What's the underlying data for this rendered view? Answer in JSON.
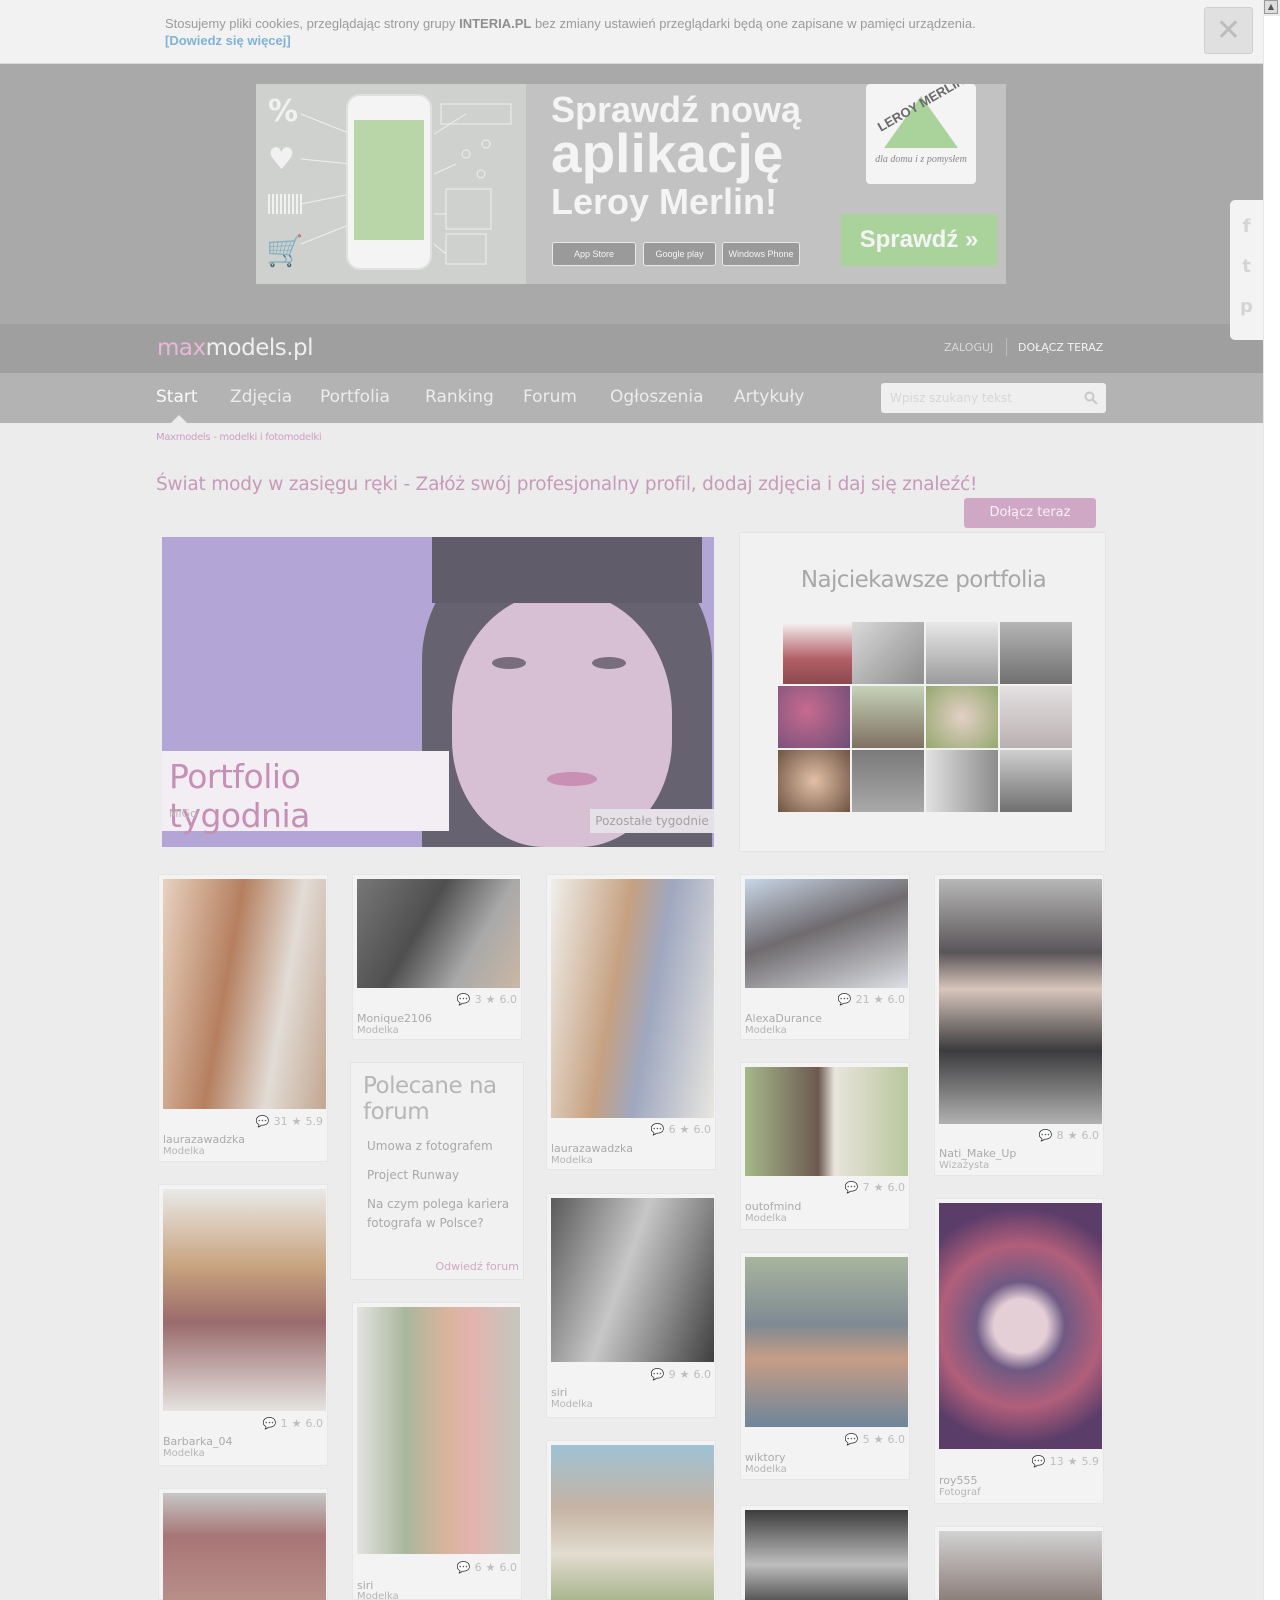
{
  "cookie": {
    "text_before": "Stosujemy pliki cookies, przeglądając strony grupy ",
    "brand": "INTERIA.PL",
    "text_after": " bez zmiany ustawień przeglądarki będą one zapisane w pamięci urządzenia.",
    "more_link": "[Dowiedz się więcej]",
    "close_glyph": "✕"
  },
  "ad": {
    "line1": "Sprawdź nową",
    "line2": "aplikację",
    "line3": "Leroy Merlin!",
    "store1": "App Store",
    "store2": "Google play",
    "store3": "Windows Phone",
    "logo_text": "LEROY MERLIN",
    "logo_sub": "dla domu i z pomysłem",
    "button": "Sprawdź »"
  },
  "header": {
    "logo_max": "max",
    "logo_rest": "models.pl",
    "login": "ZALOGUJ",
    "join": "DOŁĄCZ TERAZ"
  },
  "nav": {
    "items": [
      "Start",
      "Zdjęcia",
      "Portfolia",
      "Ranking",
      "Forum",
      "Ogłoszenia",
      "Artykuły"
    ],
    "search_placeholder": "Wpisz szukany tekst"
  },
  "breadcrumb": "Maxmodels - modelki i fotomodelki",
  "tagline": "Świat mody w zasięgu ręki - Załóż swój profesjonalny profil, dodaj zdjęcia i daj się znaleźć!",
  "join_button": "Dołącz teraz",
  "hero": {
    "title": "Portfolio tygodnia",
    "author": "MiGo",
    "others": "Pozostałe tygodnie"
  },
  "portfolios": {
    "title": "Najciekawsze portfolia"
  },
  "forum": {
    "title": "Polecane na forum",
    "links": [
      "Umowa z fotografem",
      "Project Runway",
      "Na czym polega kariera fotografa w Polsce?"
    ],
    "visit": "Odwiedź forum"
  },
  "cards": [
    {
      "name": "laurazawadzka",
      "role": "Modelka",
      "comments": "31",
      "rating": "5.9"
    },
    {
      "name": "Barbarka_04",
      "role": "Modelka",
      "comments": "1",
      "rating": "6.0"
    },
    {
      "name": "Monique2106",
      "role": "Modelka",
      "comments": "3",
      "rating": "6.0"
    },
    {
      "name": "siri",
      "role": "Modelka",
      "comments": "6",
      "rating": "6.0"
    },
    {
      "name": "laurazawadzka",
      "role": "Modelka",
      "comments": "6",
      "rating": "6.0"
    },
    {
      "name": "siri",
      "role": "Modelka",
      "comments": "9",
      "rating": "6.0"
    },
    {
      "name": "AlexaDurance",
      "role": "Modelka",
      "comments": "21",
      "rating": "6.0"
    },
    {
      "name": "outofmind",
      "role": "Modelka",
      "comments": "7",
      "rating": "6.0"
    },
    {
      "name": "wiktory",
      "role": "Modelka",
      "comments": "5",
      "rating": "6.0"
    },
    {
      "name": "Nati_Make_Up",
      "role": "Wizażysta",
      "comments": "8",
      "rating": "6.0"
    },
    {
      "name": "roy555",
      "role": "Fotograf",
      "comments": "13",
      "rating": "5.9"
    }
  ],
  "share": [
    "f",
    "t",
    "p"
  ]
}
